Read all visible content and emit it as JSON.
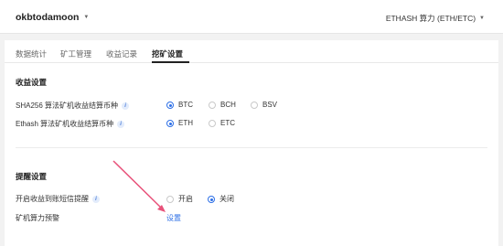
{
  "header": {
    "account_name": "okbtodamoon",
    "algorithm_selector": "ETHASH 算力 (ETH/ETC)"
  },
  "tabs": [
    {
      "label": "数据统计"
    },
    {
      "label": "矿工管理"
    },
    {
      "label": "收益记录"
    },
    {
      "label": "挖矿设置"
    }
  ],
  "income_settings": {
    "title": "收益设置",
    "sha256_label": "SHA256 算法矿机收益结算币种",
    "sha256_options": [
      "BTC",
      "BCH",
      "BSV"
    ],
    "sha256_selected": "BTC",
    "ethash_label": "Ethash 算法矿机收益结算币种",
    "ethash_options": [
      "ETH",
      "ETC"
    ],
    "ethash_selected": "ETH"
  },
  "alert_settings": {
    "title": "提醒设置",
    "sms_label": "开启收益到账短信提醒",
    "sms_options": [
      "开启",
      "关闭"
    ],
    "sms_selected": "关闭",
    "hashrate_label": "矿机算力预警",
    "hashrate_link": "设置"
  },
  "colors": {
    "accent": "#2d6fe6",
    "annotation_arrow": "#e8527a"
  }
}
